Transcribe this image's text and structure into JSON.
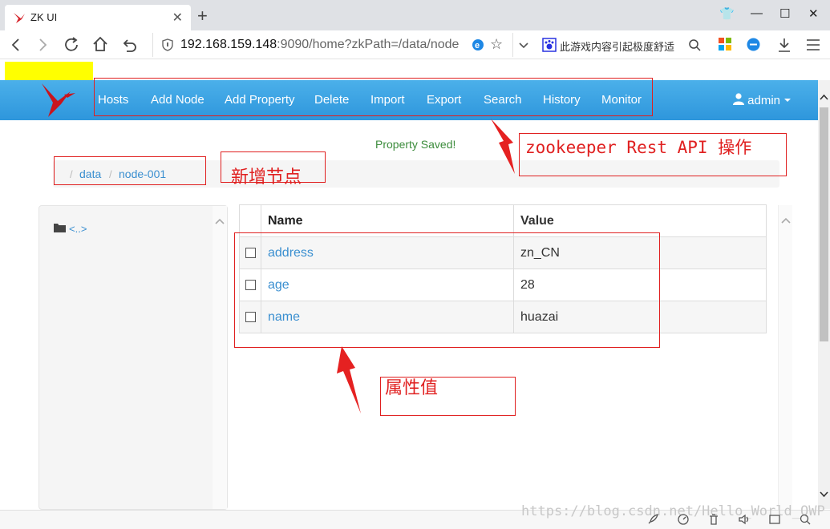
{
  "browser": {
    "tab_title": "ZK UI",
    "tab_close": "✕",
    "new_tab": "+",
    "url_host": "192.168.159.148",
    "url_rest": ":9090/home?zkPath=/data/node",
    "search_hint": "此游戏内容引起极度舒适",
    "controls": {
      "shirt": "👕",
      "minimize": "—",
      "maximize": "☐",
      "close": "✕"
    }
  },
  "app": {
    "nav": [
      "Hosts",
      "Add Node",
      "Add Property",
      "Delete",
      "Import",
      "Export",
      "Search",
      "History",
      "Monitor"
    ],
    "user": "admin",
    "flash_message": "Property Saved!",
    "breadcrumb": {
      "separator": "/",
      "items": [
        "data",
        "node-001"
      ]
    },
    "updir": "<..>",
    "table": {
      "headers": {
        "name": "Name",
        "value": "Value"
      },
      "rows": [
        {
          "name": "address",
          "value": "zn_CN"
        },
        {
          "name": "age",
          "value": "28"
        },
        {
          "name": "name",
          "value": "huazai"
        }
      ]
    },
    "brand_color": "#2e96dc"
  },
  "annotations": {
    "api_ops": "zookeeper Rest API 操作",
    "new_node": "新增节点",
    "prop_values": "属性值"
  },
  "watermark": "https://blog.csdn.net/Hello_World_QWP"
}
